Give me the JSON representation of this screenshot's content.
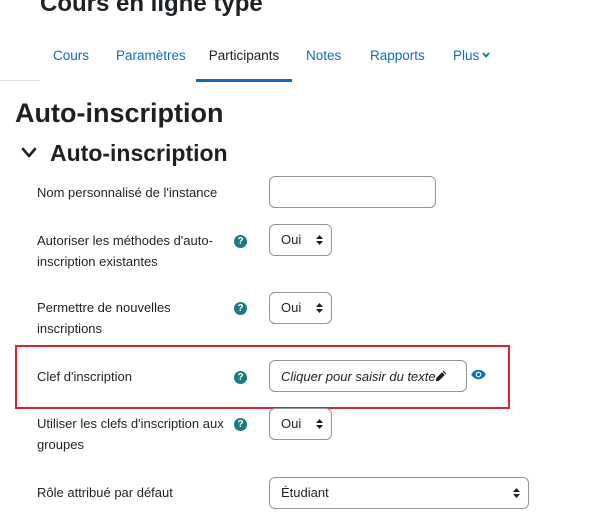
{
  "course": {
    "title": "Cours en ligne type"
  },
  "nav": {
    "items": [
      {
        "label": "Cours"
      },
      {
        "label": "Paramètres"
      },
      {
        "label": "Participants"
      },
      {
        "label": "Notes"
      },
      {
        "label": "Rapports"
      },
      {
        "label": "Plus"
      }
    ],
    "active": "Participants"
  },
  "page": {
    "title": "Auto-inscription",
    "section_title": "Auto-inscription"
  },
  "form": {
    "instance_name": {
      "label": "Nom personnalisé de l'instance",
      "value": ""
    },
    "allow_existing": {
      "label": "Autoriser les méthodes d'auto-inscription existantes",
      "value": "Oui"
    },
    "allow_new": {
      "label": "Permettre de nouvelles inscriptions",
      "value": "Oui"
    },
    "enrol_key": {
      "label": "Clef d'inscription",
      "placeholder": "Cliquer pour saisir du texte"
    },
    "group_keys": {
      "label": "Utiliser les clefs d'inscription aux groupes",
      "value": "Oui"
    },
    "default_role": {
      "label": "Rôle attribué par défaut",
      "value": "Étudiant"
    }
  },
  "icons": {
    "help": "question-circle-icon",
    "edit": "pencil-icon",
    "reveal": "eye-icon",
    "collapse": "chevron-down-icon",
    "select": "sort-arrows-icon"
  },
  "colors": {
    "link": "#0f6cbf",
    "help_icon": "#1a7a7f",
    "highlight_border": "#d9232d",
    "input_border": "#8f959e"
  }
}
